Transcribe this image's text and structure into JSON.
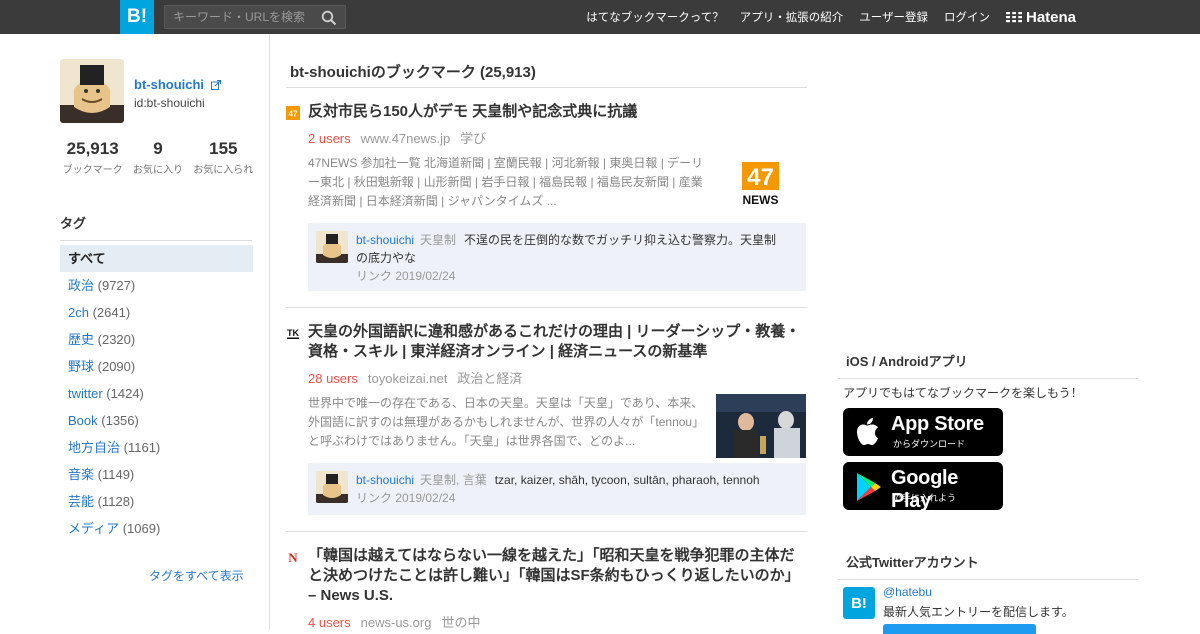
{
  "header": {
    "logo": "B!",
    "search_placeholder": "キーワード・URLを検索",
    "nav": [
      "はてなブックマークって？",
      "アプリ・拡張の紹介",
      "ユーザー登録",
      "ログイン"
    ],
    "brand": "Hatena"
  },
  "profile": {
    "name": "bt-shouichi",
    "id": "id:bt-shouichi",
    "stats": [
      {
        "num": "25,913",
        "label": "ブックマーク"
      },
      {
        "num": "9",
        "label": "お気に入り"
      },
      {
        "num": "155",
        "label": "お気に入られ"
      }
    ]
  },
  "tags": {
    "title": "タグ",
    "all_label": "すべて",
    "items": [
      {
        "name": "政治",
        "count": "(9727)"
      },
      {
        "name": "2ch",
        "count": "(2641)"
      },
      {
        "name": "歴史",
        "count": "(2320)"
      },
      {
        "name": "野球",
        "count": "(2090)"
      },
      {
        "name": "twitter",
        "count": "(1424)"
      },
      {
        "name": "Book",
        "count": "(1356)"
      },
      {
        "name": "地方自治",
        "count": "(1161)"
      },
      {
        "name": "音楽",
        "count": "(1149)"
      },
      {
        "name": "芸能",
        "count": "(1128)"
      },
      {
        "name": "メディア",
        "count": "(1069)"
      }
    ],
    "show_all": "タグをすべて表示"
  },
  "main": {
    "title": "bt-shouichiのブックマーク (25,913)",
    "entries": [
      {
        "favicon": "47",
        "title": "反対市民ら150人がデモ 天皇制や記念式典に抗議",
        "users": "2 users",
        "domain": "www.47news.jp",
        "category": "学び",
        "description": "47NEWS 参加社一覧 北海道新聞 | 室蘭民報 | 河北新報 | 東奥日報 | デーリー東北 | 秋田魁新報 | 山形新聞 | 岩手日報 | 福島民報 | 福島民友新聞 | 産業経済新聞 | 日本経済新聞 | ジャパンタイムズ ...",
        "thumb_text": "47",
        "thumb_sub": "NEWS",
        "comment": {
          "user": "bt-shouichi",
          "tags": "天皇制",
          "text": "不逞の民を圧倒的な数でガッチリ抑え込む警察力。天皇制の底力やな",
          "date": "リンク 2019/02/24"
        }
      },
      {
        "favicon": "TK",
        "title": "天皇の外国語訳に違和感があるこれだけの理由 | リーダーシップ・教養・資格・スキル | 東洋経済オンライン | 経済ニュースの新基準",
        "users": "28 users",
        "domain": "toyokeizai.net",
        "category": "政治と経済",
        "description": "世界中で唯一の存在である、日本の天皇。天皇は「天皇」であり、本来、外国語に訳すのは無理があるかもしれませんが、世界の人々が「tennou」と呼ぶわけではありません。「天皇」は世界各国で、どのよ...",
        "comment": {
          "user": "bt-shouichi",
          "tags": "天皇制, 言葉",
          "text": "tzar, kaizer, shāh, tycoon, sultān, pharaoh, tennoh",
          "date": "リンク 2019/02/24"
        }
      },
      {
        "favicon": "N",
        "title": "「韓国は越えてはならない一線を越えた」「昭和天皇を戦争犯罪の主体だと決めつけたことは許し難い」「韓国はSF条約もひっくり返したいのか」 – News U.S.",
        "users": "4 users",
        "domain": "news-us.org",
        "category": "世の中"
      }
    ]
  },
  "right": {
    "app_title": "iOS / Androidアプリ",
    "app_text": "アプリでもはてなブックマークを楽しもう！",
    "appstore_big": "App Store",
    "appstore_small": "からダウンロード",
    "gplay_big": "Google Play",
    "gplay_small": "で手に入れよう",
    "twitter_title": "公式Twitterアカウント",
    "twitter_avatar": "B!",
    "twitter_handle": "@hatebu",
    "twitter_desc": "最新人気エントリーを配信します。"
  },
  "colors": {
    "accent": "#00a4de",
    "link": "#2478c8",
    "users": "#e8524a",
    "header": "#3b3b3b"
  }
}
